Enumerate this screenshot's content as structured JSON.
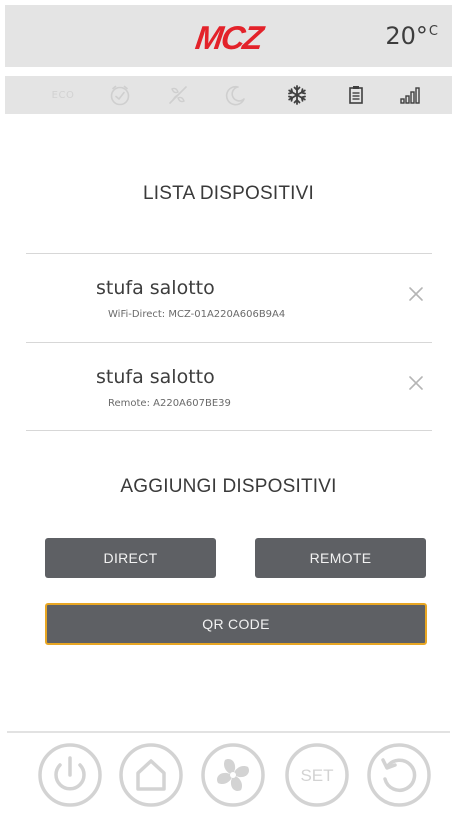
{
  "header": {
    "brand": "MCZ",
    "temperature": "20°",
    "temperature_unit": "C"
  },
  "status_bar": {
    "eco_label": "ECO",
    "icons": [
      "eco",
      "clock-icon",
      "fan-off-icon",
      "moon-icon",
      "snowflake-icon",
      "pellet-tank-icon",
      "signal-icon"
    ]
  },
  "device_list": {
    "title": "LISTA DISPOSITIVI",
    "devices": [
      {
        "name": "stufa salotto",
        "detail": "WiFi-Direct: MCZ-01A220A606B9A4"
      },
      {
        "name": "stufa salotto",
        "detail": "Remote: A220A607BE39"
      }
    ]
  },
  "add_devices": {
    "title": "AGGIUNGI DISPOSITIVI",
    "direct_label": "DIRECT",
    "remote_label": "REMOTE",
    "qr_label": "QR CODE"
  },
  "bottom_nav": {
    "set_label": "SET",
    "icons": [
      "power-icon",
      "home-icon",
      "fan-icon",
      "set-icon",
      "refresh-icon"
    ]
  },
  "colors": {
    "brand_red": "#e3222a",
    "button_gray": "#5e6064",
    "qr_border": "#e8a623",
    "bar_gray": "#e4e4e4",
    "icon_gray": "#d0d0d0"
  }
}
